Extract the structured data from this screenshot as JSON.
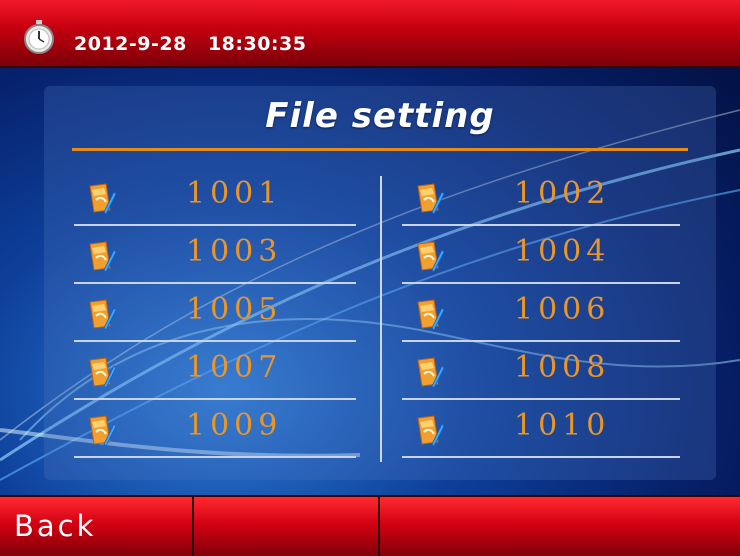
{
  "header": {
    "date": "2012-9-28",
    "time": "18:30:35",
    "icon": "stopwatch-icon"
  },
  "panel": {
    "title": "File setting",
    "files": [
      {
        "number": "1001",
        "icon": "file-edit-icon"
      },
      {
        "number": "1002",
        "icon": "file-edit-icon"
      },
      {
        "number": "1003",
        "icon": "file-edit-icon"
      },
      {
        "number": "1004",
        "icon": "file-edit-icon"
      },
      {
        "number": "1005",
        "icon": "file-edit-icon"
      },
      {
        "number": "1006",
        "icon": "file-edit-icon"
      },
      {
        "number": "1007",
        "icon": "file-edit-icon"
      },
      {
        "number": "1008",
        "icon": "file-edit-icon"
      },
      {
        "number": "1009",
        "icon": "file-edit-icon"
      },
      {
        "number": "1010",
        "icon": "file-edit-icon"
      }
    ]
  },
  "footer": {
    "back_label": "Back"
  },
  "colors": {
    "header_red": "#c80010",
    "accent_orange": "#e88a16",
    "number_orange": "#e8962a",
    "background_blue": "#0d3f9a"
  }
}
